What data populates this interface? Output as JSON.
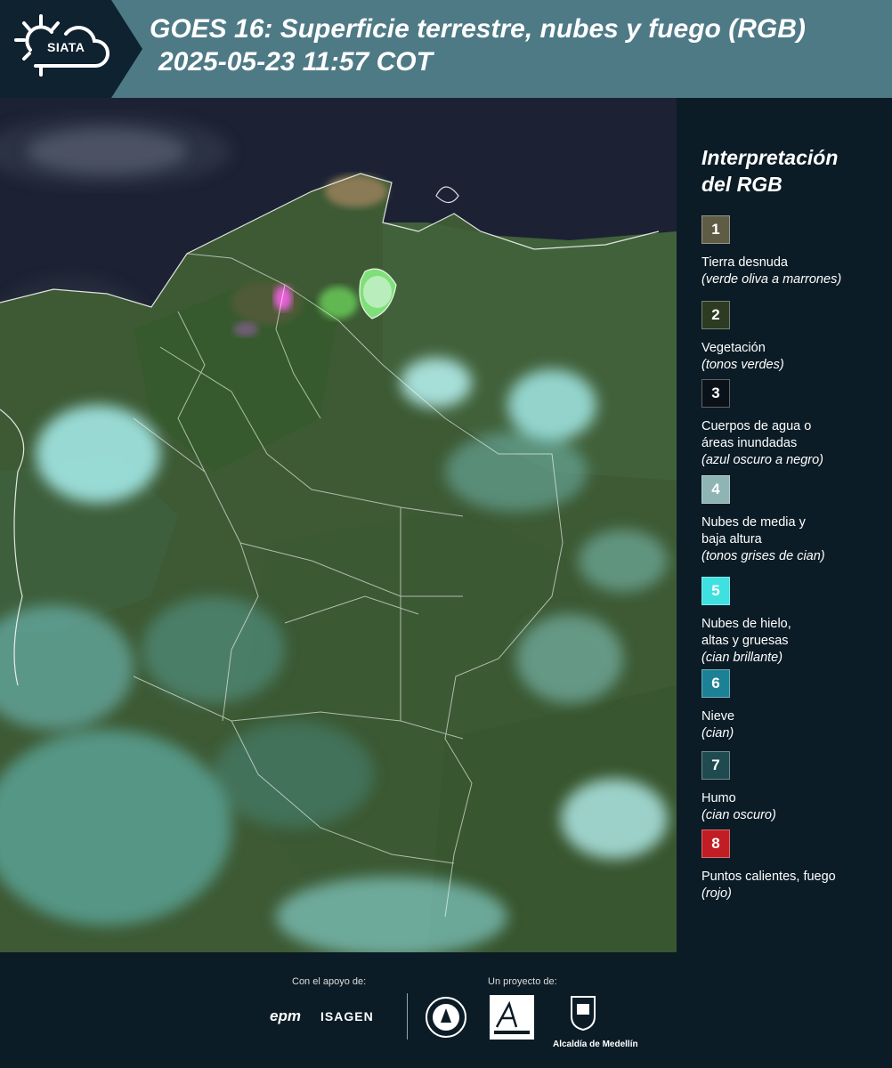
{
  "header": {
    "logo_text": "SIATA",
    "title_line1": "GOES 16: Superficie terrestre, nubes y fuego (RGB)",
    "title_line2": "2025-05-23 11:57 COT"
  },
  "legend": {
    "title_line1": "Interpretación",
    "title_line2": "del RGB",
    "items": [
      {
        "num": "1",
        "color": "#5f5c45",
        "label_lines": [
          "Tierra desnuda"
        ],
        "note": "(verde oliva a marrones)"
      },
      {
        "num": "2",
        "color": "#2c3b22",
        "label_lines": [
          "Vegetación"
        ],
        "note": "(tonos verdes)"
      },
      {
        "num": "3",
        "color": "#0b1118",
        "label_lines": [
          "Cuerpos de agua o",
          "áreas inundadas"
        ],
        "note": "(azul oscuro a negro)"
      },
      {
        "num": "4",
        "color": "#8fb4b4",
        "label_lines": [
          "Nubes de media y",
          "baja altura"
        ],
        "note": "(tonos grises de cian)"
      },
      {
        "num": "5",
        "color": "#3fe0e0",
        "label_lines": [
          "Nubes de hielo,",
          "altas y gruesas"
        ],
        "note": "(cian brillante)"
      },
      {
        "num": "6",
        "color": "#1d8196",
        "label_lines": [
          "Nieve"
        ],
        "note": "(cian)"
      },
      {
        "num": "7",
        "color": "#1f4a50",
        "label_lines": [
          "Humo"
        ],
        "note": "(cian oscuro)"
      },
      {
        "num": "8",
        "color": "#c01e24",
        "label_lines": [
          "Puntos calientes, fuego"
        ],
        "note": "(rojo)"
      }
    ]
  },
  "footer": {
    "support_label": "Con el apoyo de:",
    "project_label": "Un proyecto de:",
    "sponsors": [
      "epm",
      "ISAGEN"
    ],
    "partners": [
      "Área Metropolitana Valle de Aburrá",
      "Alcaldía de Medellín"
    ]
  }
}
